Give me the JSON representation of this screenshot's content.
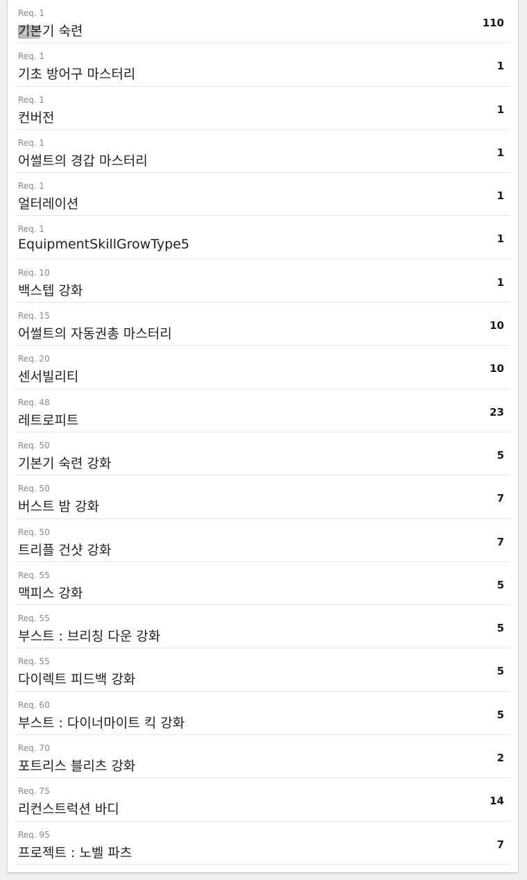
{
  "skills": [
    {
      "req": "Req. 1",
      "name": "기본기 숙련",
      "value": "110"
    },
    {
      "req": "Req. 1",
      "name": "기초 방어구 마스터리",
      "value": "1"
    },
    {
      "req": "Req. 1",
      "name": "컨버전",
      "value": "1"
    },
    {
      "req": "Req. 1",
      "name": "어썰트의 경갑 마스터리",
      "value": "1"
    },
    {
      "req": "Req. 1",
      "name": "얼터레이션",
      "value": "1"
    },
    {
      "req": "Req. 1",
      "name": "EquipmentSkillGrowType5",
      "value": "1"
    },
    {
      "req": "Req. 10",
      "name": "백스텝 강화",
      "value": "1"
    },
    {
      "req": "Req. 15",
      "name": "어썰트의 자동권총 마스터리",
      "value": "10"
    },
    {
      "req": "Req. 20",
      "name": "센서빌리티",
      "value": "10"
    },
    {
      "req": "Req. 48",
      "name": "레트로피트",
      "value": "23"
    },
    {
      "req": "Req. 50",
      "name": "기본기 숙련 강화",
      "value": "5"
    },
    {
      "req": "Req. 50",
      "name": "버스트 밤 강화",
      "value": "7"
    },
    {
      "req": "Req. 50",
      "name": "트리플 건샷 강화",
      "value": "7"
    },
    {
      "req": "Req. 55",
      "name": "맥피스 강화",
      "value": "5"
    },
    {
      "req": "Req. 55",
      "name": "부스트 : 브리칭 다운 강화",
      "value": "5"
    },
    {
      "req": "Req. 55",
      "name": "다이렉트 피드백 강화",
      "value": "5"
    },
    {
      "req": "Req. 60",
      "name": "부스트 : 다이너마이트 킥 강화",
      "value": "5"
    },
    {
      "req": "Req. 70",
      "name": "포트리스 블리츠 강화",
      "value": "2"
    },
    {
      "req": "Req. 75",
      "name": "리컨스트럭션 바디",
      "value": "14"
    },
    {
      "req": "Req. 95",
      "name": "프로젝트 : 노벨 파츠",
      "value": "7"
    }
  ]
}
